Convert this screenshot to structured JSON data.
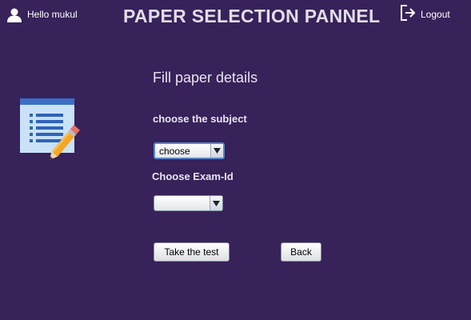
{
  "header": {
    "greeting": "Hello mukul",
    "title": "PAPER SELECTION PANNEL",
    "logout_label": "Logout",
    "user_icon": "user-icon",
    "logout_icon": "logout-icon"
  },
  "form": {
    "title": "Fill paper details",
    "subject_label": "choose the subject",
    "subject_value": "choose",
    "exam_label": "Choose Exam-Id",
    "exam_value": ""
  },
  "buttons": {
    "take_test": "Take the test",
    "back": "Back"
  },
  "illustration": "document-pencil-icon",
  "colors": {
    "background": "#37225a",
    "title_text": "#e2dcea",
    "combo_focus_border": "#5b85c6"
  }
}
